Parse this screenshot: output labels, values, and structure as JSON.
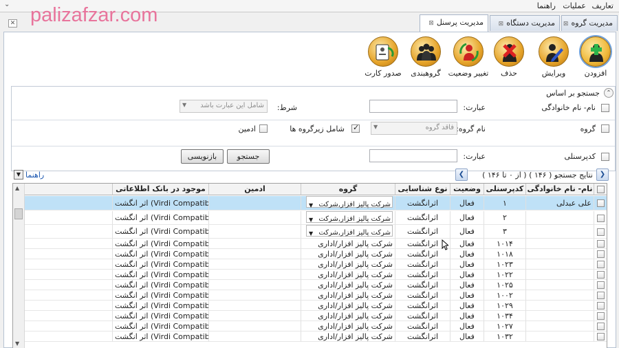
{
  "menu": {
    "items": [
      "تعاریف",
      "عملیات",
      "راهنما"
    ]
  },
  "watermark": "palizafzar.com",
  "tabs": [
    {
      "label": "مدیریت گروه",
      "active": false
    },
    {
      "label": "مدیریت دستگاه",
      "active": false
    },
    {
      "label": "مدیریت پرسنل",
      "active": true
    }
  ],
  "toolbar": {
    "add": "افزودن",
    "edit": "ویرایش",
    "delete": "حذف",
    "change_status": "تغییر وضعیت",
    "grouping": "گروهبندی",
    "issue_card": "صدور کارت"
  },
  "search": {
    "header": "جستجو بر اساس",
    "name_label": "نام- نام خانوادگی",
    "condition_label": "شرط:",
    "condition_value": "شامل این عبارت باشد",
    "phrase_label": "عبارت:",
    "group_label": "گروه",
    "group_name_label": "نام گروه:",
    "group_name_value": "فاقد گروه",
    "include_subgroups": "شامل زیرگروه ها",
    "admin_label": "ادمین",
    "usercode_label": "کدپرسنلی",
    "phrase2_label": "عبارت:",
    "search_button": "جستجو",
    "reset_button": "بازنویسی"
  },
  "results": {
    "summary": "نتایج جستجو ( ۱۴۶ ) ( از ۰ تا ۱۴۶ )",
    "help": "راهنما"
  },
  "grid": {
    "headers": {
      "name": "نام- نام خانوادگی",
      "code": "کدپرسنلی",
      "status": "وضعیت",
      "auth_type": "نوع شناسایی",
      "group": "گروه",
      "admin": "ادمین",
      "bank": "موجود در بانک اطلاعاتی"
    },
    "rows": [
      {
        "name": "علی عبدلی",
        "code": "۱",
        "status": "فعال",
        "auth": "اثرانگشت",
        "group": "شرکت پالیز افزار,شرکت",
        "combo": true,
        "admin": "",
        "bank": "اثر انگشت (Virdi Compatible)",
        "selected": true
      },
      {
        "name": "",
        "code": "۲",
        "status": "فعال",
        "auth": "اثرانگشت",
        "group": "شرکت پالیز افزار,شرکت",
        "combo": true,
        "admin": "",
        "bank": "اثر انگشت (Virdi Compatible)",
        "selected": false
      },
      {
        "name": "",
        "code": "۳",
        "status": "فعال",
        "auth": "اثرانگشت",
        "group": "شرکت پالیز افزار,شرکت",
        "combo": true,
        "admin": "",
        "bank": "اثر انگشت (Virdi Compatible)",
        "selected": false
      },
      {
        "name": "",
        "code": "۱۰۱۴",
        "status": "فعال",
        "auth": "اثرانگشت",
        "group": "شرکت پالیز افزار/اداری",
        "combo": false,
        "admin": "",
        "bank": "اثر انگشت (Virdi Compatible)",
        "selected": false
      },
      {
        "name": "",
        "code": "۱۰۱۸",
        "status": "فعال",
        "auth": "اثرانگشت",
        "group": "شرکت پالیز افزار/اداری",
        "combo": false,
        "admin": "",
        "bank": "اثر انگشت (Virdi Compatible)",
        "selected": false
      },
      {
        "name": "",
        "code": "۱۰۲۳",
        "status": "فعال",
        "auth": "اثرانگشت",
        "group": "شرکت پالیز افزار/اداری",
        "combo": false,
        "admin": "",
        "bank": "اثر انگشت (Virdi Compatible)",
        "selected": false
      },
      {
        "name": "",
        "code": "۱۰۲۲",
        "status": "فعال",
        "auth": "اثرانگشت",
        "group": "شرکت پالیز افزار/اداری",
        "combo": false,
        "admin": "",
        "bank": "اثر انگشت (Virdi Compatible)",
        "selected": false
      },
      {
        "name": "",
        "code": "۱۰۲۵",
        "status": "فعال",
        "auth": "اثرانگشت",
        "group": "شرکت پالیز افزار/اداری",
        "combo": false,
        "admin": "",
        "bank": "اثر انگشت (Virdi Compatible)",
        "selected": false
      },
      {
        "name": "",
        "code": "۱۰۰۲",
        "status": "فعال",
        "auth": "اثرانگشت",
        "group": "شرکت پالیز افزار/اداری",
        "combo": false,
        "admin": "",
        "bank": "اثر انگشت (Virdi Compatible)",
        "selected": false
      },
      {
        "name": "",
        "code": "۱۰۲۹",
        "status": "فعال",
        "auth": "اثرانگشت",
        "group": "شرکت پالیز افزار/اداری",
        "combo": false,
        "admin": "",
        "bank": "اثر انگشت (Virdi Compatible)",
        "selected": false
      },
      {
        "name": "",
        "code": "۱۰۳۴",
        "status": "فعال",
        "auth": "اثرانگشت",
        "group": "شرکت پالیز افزار/اداری",
        "combo": false,
        "admin": "",
        "bank": "اثر انگشت (Virdi Compatible)",
        "selected": false
      },
      {
        "name": "",
        "code": "۱۰۲۷",
        "status": "فعال",
        "auth": "اثرانگشت",
        "group": "شرکت پالیز افزار/اداری",
        "combo": false,
        "admin": "",
        "bank": "اثر انگشت (Virdi Compatible)",
        "selected": false
      },
      {
        "name": "",
        "code": "۱۰۳۲",
        "status": "فعال",
        "auth": "اثرانگشت",
        "group": "شرکت پالیز افزار/اداری",
        "combo": false,
        "admin": "",
        "bank": "اثر انگشت (Virdi Compatible)",
        "selected": false
      }
    ]
  }
}
